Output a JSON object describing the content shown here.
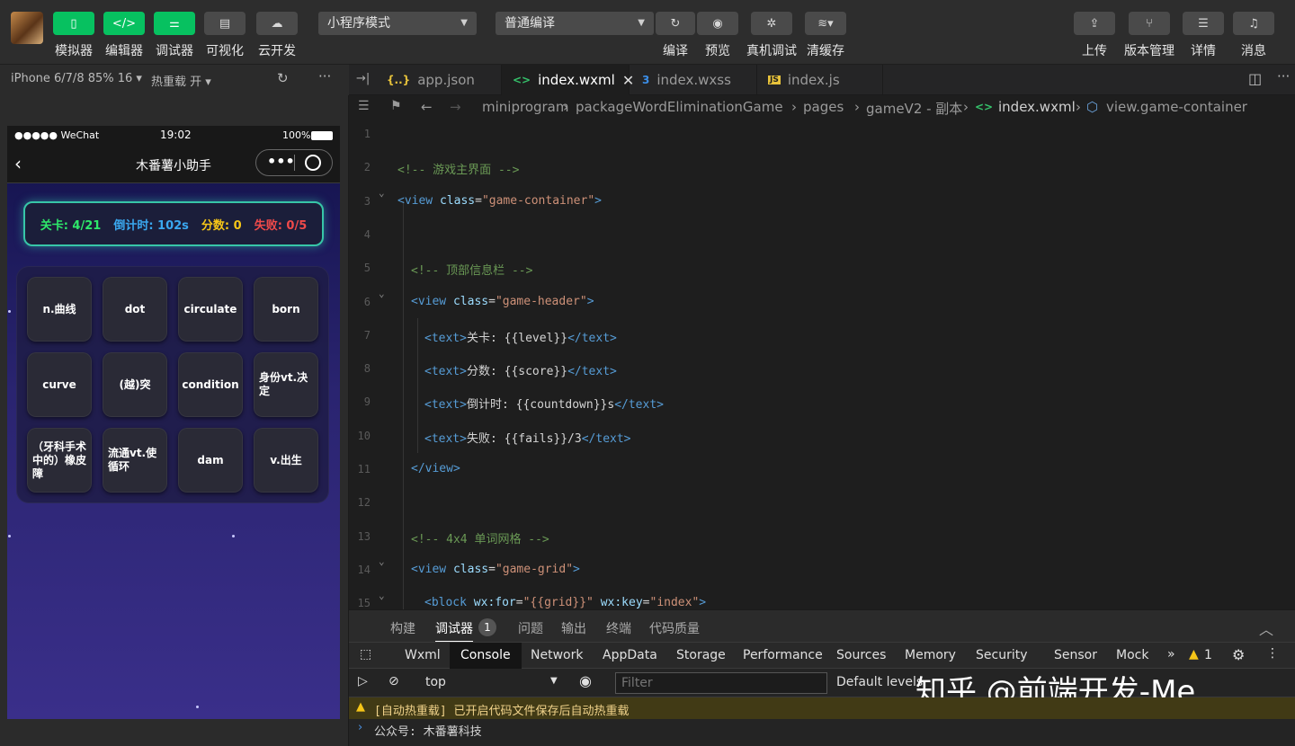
{
  "toolbar": {
    "left_buttons": [
      {
        "label": "模拟器"
      },
      {
        "label": "编辑器"
      },
      {
        "label": "调试器"
      },
      {
        "label": "可视化"
      },
      {
        "label": "云开发"
      }
    ],
    "mode_select": "小程序模式",
    "compile_select": "普通编译",
    "mid_buttons": [
      {
        "label": "编译"
      },
      {
        "label": "预览"
      },
      {
        "label": "真机调试"
      },
      {
        "label": "清缓存"
      }
    ],
    "right_buttons": [
      {
        "label": "上传"
      },
      {
        "label": "版本管理"
      },
      {
        "label": "详情"
      },
      {
        "label": "消息"
      }
    ]
  },
  "simulator": {
    "device": "iPhone 6/7/8 85% 16 ▾",
    "hot_reload": "热重载 开 ▾",
    "status_carrier": "●●●●● WeChat",
    "status_time": "19:02",
    "status_battery": "100%",
    "nav_title": "木番薯小助手",
    "hud": {
      "level": "关卡: 4/21",
      "countdown": "倒计时: 102s",
      "score": "分数: 0",
      "fails": "失败: 0/5"
    },
    "tiles": [
      "n.曲线",
      "dot",
      "circulate",
      "born",
      "curve",
      "(越)突",
      "condition",
      "身份vt.决定",
      "（牙科手术中的）橡皮障",
      "流通vt.使循环",
      "dam",
      "v.出生"
    ]
  },
  "editor": {
    "tabs": [
      {
        "label": "app.json",
        "icon": "{..}"
      },
      {
        "label": "index.wxml",
        "icon": "<>"
      },
      {
        "label": "index.wxss",
        "icon": "3"
      },
      {
        "label": "index.js",
        "icon": "JS"
      }
    ],
    "breadcrumb": [
      "miniprogram",
      "packageWordEliminationGame",
      "pages",
      "gameV2 - 副本",
      "index.wxml",
      "view.game-container"
    ],
    "lines": [
      {
        "n": "1",
        "indent": 0,
        "parts": []
      },
      {
        "n": "2",
        "indent": 0,
        "parts": [
          {
            "t": "<!-- 游戏主界面 -->",
            "c": "#6a9955"
          }
        ]
      },
      {
        "n": "3",
        "indent": 0,
        "parts": [
          {
            "t": "<view",
            "c": "#569cd6"
          },
          {
            "t": " class",
            "c": "#9cdcfe"
          },
          {
            "t": "=",
            "c": "#d4d4d4"
          },
          {
            "t": "\"game-container\"",
            "c": "#ce9178"
          },
          {
            "t": ">",
            "c": "#569cd6"
          }
        ]
      },
      {
        "n": "4",
        "indent": 1,
        "parts": []
      },
      {
        "n": "5",
        "indent": 1,
        "parts": [
          {
            "t": "<!-- 顶部信息栏 -->",
            "c": "#6a9955"
          }
        ]
      },
      {
        "n": "6",
        "indent": 1,
        "parts": [
          {
            "t": "<view",
            "c": "#569cd6"
          },
          {
            "t": " class",
            "c": "#9cdcfe"
          },
          {
            "t": "=",
            "c": "#d4d4d4"
          },
          {
            "t": "\"game-header\"",
            "c": "#ce9178"
          },
          {
            "t": ">",
            "c": "#569cd6"
          }
        ]
      },
      {
        "n": "7",
        "indent": 2,
        "parts": [
          {
            "t": "<text>",
            "c": "#569cd6"
          },
          {
            "t": "关卡: {{level}}",
            "c": "#d4d4d4"
          },
          {
            "t": "</text>",
            "c": "#569cd6"
          }
        ]
      },
      {
        "n": "8",
        "indent": 2,
        "parts": [
          {
            "t": "<text>",
            "c": "#569cd6"
          },
          {
            "t": "分数: {{score}}",
            "c": "#d4d4d4"
          },
          {
            "t": "</text>",
            "c": "#569cd6"
          }
        ]
      },
      {
        "n": "9",
        "indent": 2,
        "parts": [
          {
            "t": "<text>",
            "c": "#569cd6"
          },
          {
            "t": "倒计时: {{countdown}}s",
            "c": "#d4d4d4"
          },
          {
            "t": "</text>",
            "c": "#569cd6"
          }
        ]
      },
      {
        "n": "10",
        "indent": 2,
        "parts": [
          {
            "t": "<text>",
            "c": "#569cd6"
          },
          {
            "t": "失败: {{fails}}/3",
            "c": "#d4d4d4"
          },
          {
            "t": "</text>",
            "c": "#569cd6"
          }
        ]
      },
      {
        "n": "11",
        "indent": 1,
        "parts": [
          {
            "t": "</view>",
            "c": "#569cd6"
          }
        ]
      },
      {
        "n": "12",
        "indent": 1,
        "parts": []
      },
      {
        "n": "13",
        "indent": 1,
        "parts": [
          {
            "t": "<!-- 4x4 单词网格 -->",
            "c": "#6a9955"
          }
        ]
      },
      {
        "n": "14",
        "indent": 1,
        "parts": [
          {
            "t": "<view",
            "c": "#569cd6"
          },
          {
            "t": " class",
            "c": "#9cdcfe"
          },
          {
            "t": "=",
            "c": "#d4d4d4"
          },
          {
            "t": "\"game-grid\"",
            "c": "#ce9178"
          },
          {
            "t": ">",
            "c": "#569cd6"
          }
        ]
      },
      {
        "n": "15",
        "indent": 2,
        "parts": [
          {
            "t": "<block",
            "c": "#569cd6"
          },
          {
            "t": " wx:for",
            "c": "#9cdcfe"
          },
          {
            "t": "=",
            "c": "#d4d4d4"
          },
          {
            "t": "\"{{grid}}\"",
            "c": "#ce9178"
          },
          {
            "t": " wx:key",
            "c": "#9cdcfe"
          },
          {
            "t": "=",
            "c": "#d4d4d4"
          },
          {
            "t": "\"index\"",
            "c": "#ce9178"
          },
          {
            "t": ">",
            "c": "#569cd6"
          }
        ]
      }
    ]
  },
  "devtools": {
    "top_tabs": [
      "构建",
      "调试器",
      "问题",
      "输出",
      "终端",
      "代码质量"
    ],
    "debugger_badge": "1",
    "panel_tabs": [
      "Wxml",
      "Console",
      "Network",
      "AppData",
      "Storage",
      "Performance",
      "Sources",
      "Memory",
      "Security",
      "Sensor",
      "Mock"
    ],
    "warn_count": "1",
    "context": "top",
    "filter_placeholder": "Filter",
    "levels": "Default levels",
    "watermark": "知乎 @前端开发-Me",
    "warn_message": "[自动热重载] 已开启代码文件保存后自动热重载",
    "log_message": "公众号: 木番薯科技"
  },
  "colors": {
    "accent_green": "#07c160",
    "hud_level": "#2ee86a",
    "hud_countdown": "#3aa8f0",
    "hud_score": "#f5c518",
    "hud_fails": "#f04a4a"
  }
}
